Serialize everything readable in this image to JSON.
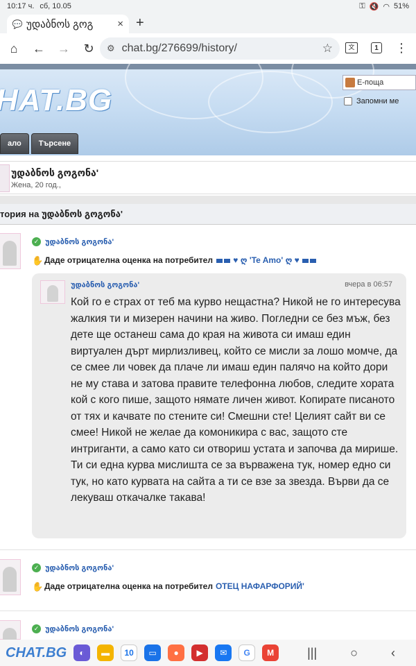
{
  "statusbar": {
    "time": "10:17 ч.",
    "date": "сб, 10.05",
    "battery": "51%"
  },
  "browser": {
    "tab_title": "უდაბნოს გოგ",
    "tab_close": "×",
    "new_tab": "+",
    "url": "chat.bg/276699/history/",
    "tab_count": "1"
  },
  "site": {
    "logo": "HAT.BG",
    "email_placeholder": "E-поща",
    "remember_label": "Запомни ме",
    "nav_tabs": [
      "ало",
      "Търсене"
    ]
  },
  "profile": {
    "name": "უდაბნოს გოგონა'",
    "sub": "Жена, 20 год.,"
  },
  "history": {
    "title": "тория на უდაბნოს გოგონა'"
  },
  "entries": [
    {
      "user": "უდაბნოს გოგონა'",
      "action": "Даде отрицателна оценка на потребител",
      "target": "ღ 'Te Amo' ღ"
    },
    {
      "user": "უდაბნოს გოგონა'",
      "action": "Даде отрицателна оценка на потребител",
      "target": "ОТЕЦ НАФАРФОРИЙ'"
    },
    {
      "user": "უდაბნოს გოგონა'"
    }
  ],
  "message": {
    "user": "უდაბნოს გოგონა'",
    "time": "вчера в 06:57",
    "text": "Кой го е страх от теб ма курво нещастна? Никой не го интересува жалкия ти и мизерен начини на живо. Погледни се без мъж, без дете ще останеш сама до края на живота си имаш един виртуален дърт мирлизливец, който се мисли за лошо момче, да се смее ли човек да плаче ли имаш един палячо на който дори не му става и затова правите телефонна любов, следите хората кой с кого пише, защото нямате личен живот. Копирате писаното от тях и качвате по стените си! Смешни сте! Целият сайт ви се смее! Никой не желае да комоникира с вас, защото сте интриганти, а само като си отвориш устата и започва да мирише. Ти си една курва мислишта се за върважена тук, номер едно си тук, но като курвата на сайта а ти се взе за звезда. Върви да се лекуваш откачалке такава!"
  },
  "dock": {
    "logo": "CHAT.BG",
    "calendar_day": "10"
  },
  "colors": {
    "link": "#2a5fb0",
    "header_bg": "#c6dcf2",
    "check": "#4caf50"
  }
}
